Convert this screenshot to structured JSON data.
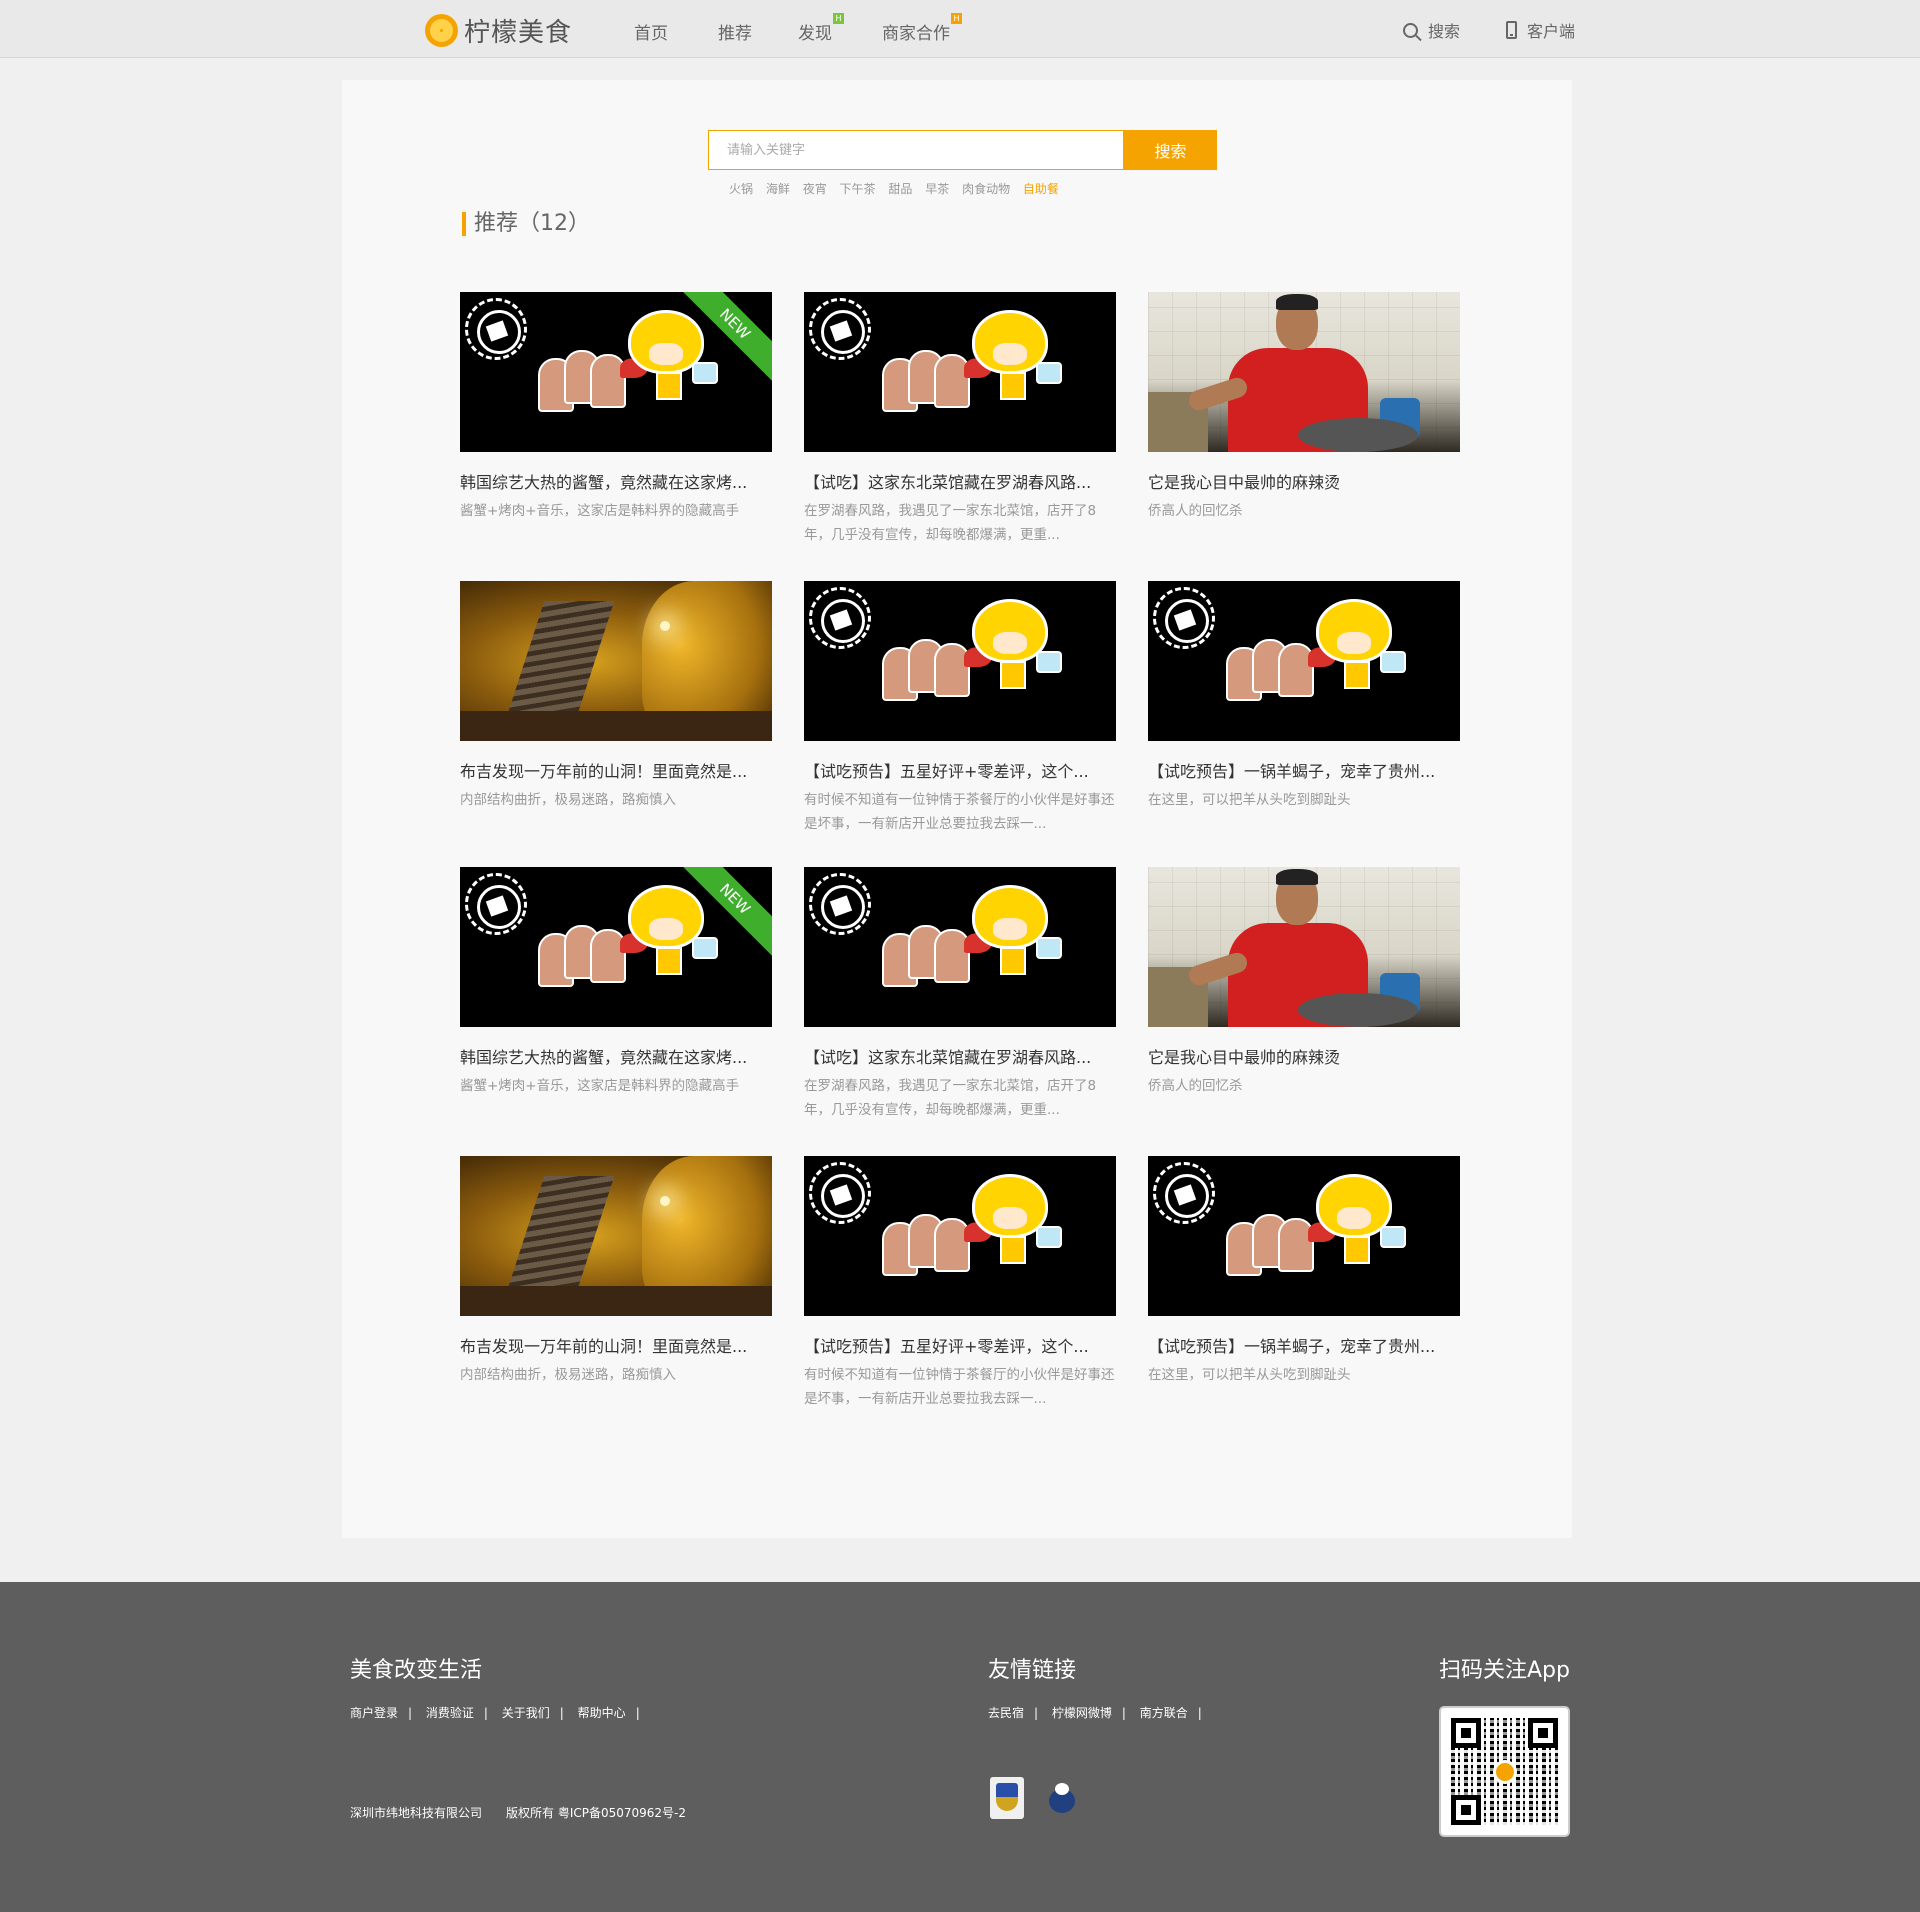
{
  "header": {
    "logo_text": "柠檬美食",
    "nav": [
      {
        "label": "首页",
        "badge": ""
      },
      {
        "label": "推荐",
        "badge": ""
      },
      {
        "label": "发现",
        "badge": "H"
      },
      {
        "label": "商家合作",
        "badge": "H"
      }
    ],
    "search_label": "搜索",
    "client_label": "客户端"
  },
  "search": {
    "placeholder": "请输入关键字",
    "button_label": "搜索",
    "hot_words": [
      "火锅",
      "海鲜",
      "夜宵",
      "下午茶",
      "甜品",
      "早茶",
      "肉食动物",
      "自助餐"
    ],
    "highlighted_word": "自助餐"
  },
  "section": {
    "title": "推荐（12）"
  },
  "cards": [
    {
      "title": "韩国综艺大热的酱蟹，竟然藏在这家烤...",
      "desc": "酱蟹+烤肉+音乐，这家店是韩料界的隐藏高手",
      "image": "lemon-mascot-new",
      "badge": "NEW"
    },
    {
      "title": "【试吃】这家东北菜馆藏在罗湖春风路...",
      "desc": "在罗湖春风路，我遇见了一家东北菜馆，店开了8年，几乎没有宣传，却每晚都爆满，更重...",
      "image": "lemon-mascot",
      "badge": ""
    },
    {
      "title": "它是我心目中最帅的麻辣烫",
      "desc": "侨高人的回忆杀",
      "image": "chef-photo",
      "badge": ""
    },
    {
      "title": "布吉发现一万年前的山洞！里面竟然是...",
      "desc": "内部结构曲折，极易迷路，路痴慎入",
      "image": "cave-photo",
      "badge": ""
    },
    {
      "title": "【试吃预告】五星好评+零差评，这个...",
      "desc": "有时候不知道有一位钟情于茶餐厅的小伙伴是好事还是坏事，一有新店开业总要拉我去踩一...",
      "image": "lemon-mascot",
      "badge": ""
    },
    {
      "title": "【试吃预告】一锅羊蝎子，宠幸了贵州...",
      "desc": "在这里，可以把羊从头吃到脚趾头",
      "image": "lemon-mascot",
      "badge": ""
    },
    {
      "title": "韩国综艺大热的酱蟹，竟然藏在这家烤...",
      "desc": "酱蟹+烤肉+音乐，这家店是韩料界的隐藏高手",
      "image": "lemon-mascot-new",
      "badge": "NEW"
    },
    {
      "title": "【试吃】这家东北菜馆藏在罗湖春风路...",
      "desc": "在罗湖春风路，我遇见了一家东北菜馆，店开了8年，几乎没有宣传，却每晚都爆满，更重...",
      "image": "lemon-mascot",
      "badge": ""
    },
    {
      "title": "它是我心目中最帅的麻辣烫",
      "desc": "侨高人的回忆杀",
      "image": "chef-photo",
      "badge": ""
    },
    {
      "title": "布吉发现一万年前的山洞！里面竟然是...",
      "desc": "内部结构曲折，极易迷路，路痴慎入",
      "image": "cave-photo",
      "badge": ""
    },
    {
      "title": "【试吃预告】五星好评+零差评，这个...",
      "desc": "有时候不知道有一位钟情于茶餐厅的小伙伴是好事还是坏事，一有新店开业总要拉我去踩一...",
      "image": "lemon-mascot",
      "badge": ""
    },
    {
      "title": "【试吃预告】一锅羊蝎子，宠幸了贵州...",
      "desc": "在这里，可以把羊从头吃到脚趾头",
      "image": "lemon-mascot",
      "badge": ""
    }
  ],
  "footer": {
    "col1_title": "美食改变生活",
    "col1_links": [
      "商户登录",
      "消费验证",
      "关于我们",
      "帮助中心"
    ],
    "copyright": "深圳市纬地科技有限公司　　版权所有 粤ICP备05070962号-2",
    "col2_title": "友情链接",
    "col2_links": [
      "去民宿",
      "柠檬网微博",
      "南方联合"
    ],
    "col3_title": "扫码关注App"
  },
  "colors": {
    "accent": "#f5a300",
    "footer_bg": "#5e5e5e",
    "new_ribbon": "#3fae2c"
  }
}
